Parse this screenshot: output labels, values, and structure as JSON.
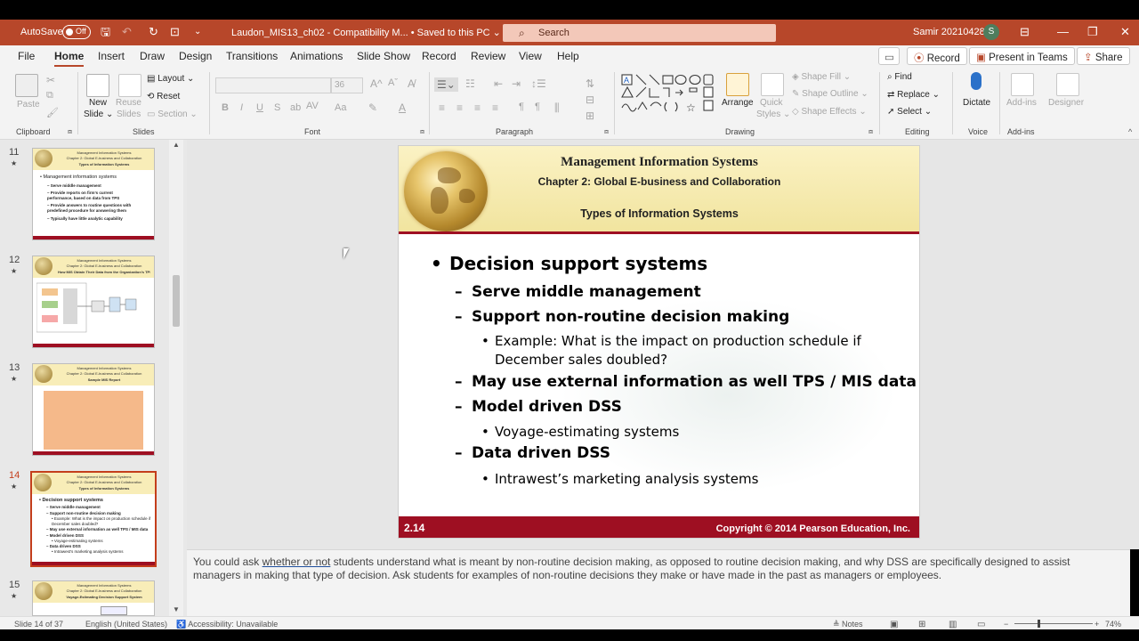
{
  "titlebar": {
    "autosave_label": "AutoSave",
    "autosave_state": "Off",
    "filename": "Laudon_MIS13_ch02  -  Compatibility M...  •  Saved to this PC ⌄",
    "search_placeholder": "Search",
    "user": "Samir 20210428",
    "avatar_initial": "S"
  },
  "menu": {
    "tabs": [
      "File",
      "Home",
      "Insert",
      "Draw",
      "Design",
      "Transitions",
      "Animations",
      "Slide Show",
      "Record",
      "Review",
      "View",
      "Help"
    ],
    "active": "Home",
    "record_btn": "Record",
    "teams_btn": "Present in Teams",
    "share_btn": "Share"
  },
  "ribbon": {
    "clipboard": {
      "label": "Clipboard",
      "paste": "Paste"
    },
    "slides": {
      "label": "Slides",
      "new_slide": "New",
      "new_slide2": "Slide ⌄",
      "reuse": "Reuse",
      "reuse2": "Slides",
      "layout": "Layout ⌄",
      "reset": "Reset",
      "section": "Section ⌄"
    },
    "font": {
      "label": "Font",
      "size": "36"
    },
    "paragraph": {
      "label": "Paragraph"
    },
    "drawing": {
      "label": "Drawing",
      "arrange": "Arrange",
      "quick": "Quick",
      "quick2": "Styles ⌄",
      "shape_fill": "Shape Fill ⌄",
      "shape_outline": "Shape Outline ⌄",
      "shape_effects": "Shape Effects ⌄"
    },
    "editing": {
      "label": "Editing",
      "find": "Find",
      "replace": "Replace ⌄",
      "select": "Select ⌄"
    },
    "voice": {
      "label": "Voice",
      "dictate": "Dictate"
    },
    "addins": {
      "label": "Add-ins",
      "addins": "Add-ins",
      "designer": "Designer"
    }
  },
  "thumbnails": [
    {
      "num": "11",
      "title": "Types of Information Systems",
      "lines": [
        "• Management information systems",
        "– Serve middle management",
        "– Provide reports on firm’s current",
        "  performance, based on data from TPS",
        "– Provide answers to routine questions with",
        "  predefined procedure for answering them",
        "– Typically have little analytic capability"
      ]
    },
    {
      "num": "12",
      "title": "How MIS Obtain Their Data from the Organization’s TPS",
      "lines": []
    },
    {
      "num": "13",
      "title": "Sample MIS Report",
      "lines": []
    },
    {
      "num": "14",
      "title": "Types of Information Systems",
      "lines": [
        "• Decision support systems",
        "– Serve middle management",
        "– Support non-routine decision making",
        "  • Example: What is the impact on production schedule if",
        "    December sales doubled?",
        "– May use external information as well TPS / MIS data",
        "– Model driven DSS",
        "  • Voyage-estimating systems",
        "– Data driven DSS",
        "  • Intrawest’s marketing analysis systems"
      ]
    },
    {
      "num": "15",
      "title": "Voyage-Estimating Decision Support System",
      "lines": []
    }
  ],
  "thumb_header": {
    "l1": "Management Information Systems",
    "l2": "Chapter 2: Global E-business and Collaboration"
  },
  "slide": {
    "title1": "Management Information Systems",
    "title2": "Chapter 2: Global E-business and Collaboration",
    "title3": "Types of Information Systems",
    "bullets": [
      {
        "level": 1,
        "text": "Decision support systems"
      },
      {
        "level": 2,
        "text": "Serve middle management"
      },
      {
        "level": 2,
        "text": "Support non-routine decision making"
      },
      {
        "level": 3,
        "text": "Example: What is the impact on production schedule if"
      },
      {
        "level": 4,
        "text": "December sales doubled?"
      },
      {
        "level": 2,
        "text": "May use external information as well TPS / MIS data"
      },
      {
        "level": 2,
        "text": "Model driven DSS"
      },
      {
        "level": 3,
        "text": "Voyage-estimating systems"
      },
      {
        "level": 2,
        "text": "Data driven DSS"
      },
      {
        "level": 3,
        "text": "Intrawest’s marketing analysis systems"
      }
    ],
    "page": "2.14",
    "copyright": "Copyright © 2014 Pearson Education, Inc."
  },
  "notes": {
    "pre": "You could ask ",
    "underlined": "whether or not",
    "post": " students understand what is meant by non-routine decision making, as opposed to routine decision making, and why DSS are specifically designed to assist managers in making that type of decision. Ask students for examples of non-routine decisions they make or have made in the past as managers or employees."
  },
  "status": {
    "slide": "Slide 14 of 37",
    "language": "English (United States)",
    "accessibility": "Accessibility: Unavailable",
    "notes": "Notes",
    "zoom": "74%"
  }
}
